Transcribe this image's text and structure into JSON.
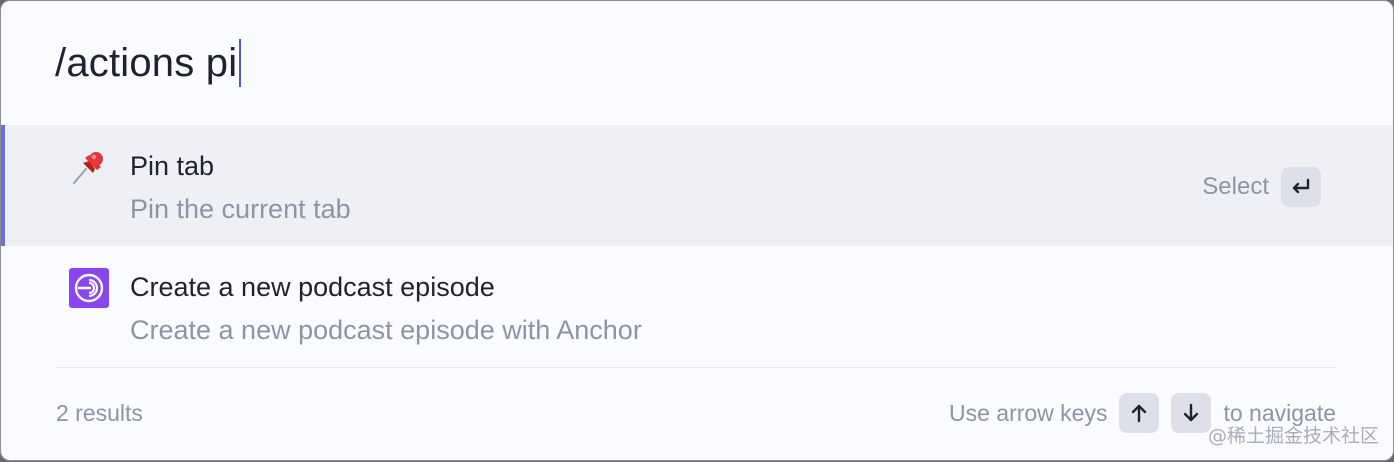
{
  "search": {
    "query": "/actions pi"
  },
  "results": [
    {
      "title": "Pin tab",
      "subtitle": "Pin the current tab",
      "icon": "pushpin-icon",
      "selected": true
    },
    {
      "title": "Create a new podcast episode",
      "subtitle": "Create a new podcast episode with Anchor",
      "icon": "anchor-podcast-icon",
      "selected": false
    }
  ],
  "select_hint": {
    "label": "Select",
    "key_icon": "return-key-icon"
  },
  "footer": {
    "count": "2 results",
    "nav_prefix": "Use arrow keys",
    "nav_suffix": "to navigate",
    "up_icon": "arrow-up-icon",
    "down_icon": "arrow-down-icon"
  },
  "watermark": "@稀土掘金技术社区",
  "colors": {
    "accent": "#6b6ee0",
    "selected_bg": "#eef0f6",
    "anchor_purple": "#8b45f0",
    "pin_red": "#d62a2a"
  }
}
